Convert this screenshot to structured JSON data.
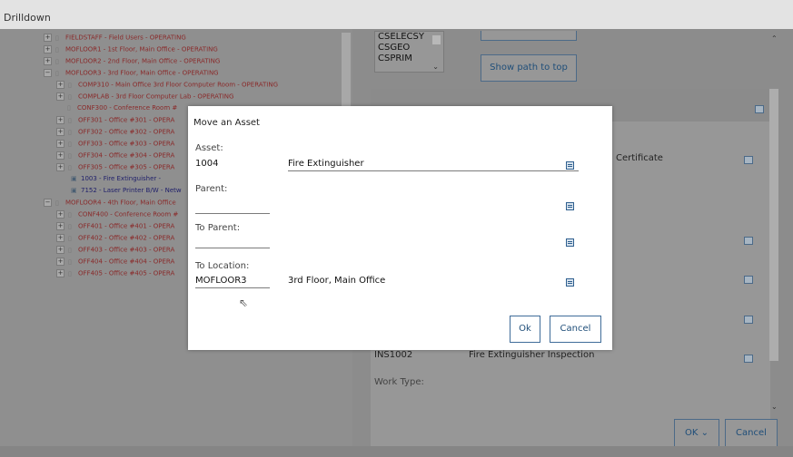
{
  "window": {
    "title": "Drilldown"
  },
  "tree": {
    "items": [
      {
        "expander": "+",
        "label": "FIELDSTAFF - Field Users - OPERATING",
        "type": "location"
      },
      {
        "expander": "+",
        "label": "MOFLOOR1 - 1st Floor, Main Office - OPERATING",
        "type": "location"
      },
      {
        "expander": "+",
        "label": "MOFLOOR2 - 2nd Floor, Main Office - OPERATING",
        "type": "location"
      },
      {
        "expander": "−",
        "label": "MOFLOOR3 - 3rd Floor, Main Office - OPERATING",
        "type": "location"
      },
      {
        "expander": "+",
        "label": "COMP310 - Main Office 3rd Floor Computer Room - OPERATING",
        "type": "location"
      },
      {
        "expander": "+",
        "label": "COMPLAB - 3rd Floor Computer Lab - OPERATING",
        "type": "location"
      },
      {
        "expander": "",
        "label": "CONF300 - Conference Room #",
        "type": "location"
      },
      {
        "expander": "+",
        "label": "OFF301 - Office #301 - OPERA",
        "type": "location"
      },
      {
        "expander": "+",
        "label": "OFF302 - Office #302 - OPERA",
        "type": "location"
      },
      {
        "expander": "+",
        "label": "OFF303 - Office #303 - OPERA",
        "type": "location"
      },
      {
        "expander": "+",
        "label": "OFF304 - Office #304 - OPERA",
        "type": "location"
      },
      {
        "expander": "+",
        "label": "OFF305 - Office #305 - OPERA",
        "type": "location"
      },
      {
        "expander": "",
        "label": "1003 - Fire Extinguisher -",
        "type": "asset"
      },
      {
        "expander": "",
        "label": "7152 - Laser Printer B/W - Netw",
        "type": "asset"
      },
      {
        "expander": "−",
        "label": "MOFLOOR4 - 4th Floor, Main Office",
        "type": "location"
      },
      {
        "expander": "+",
        "label": "CONF400 - Conference Room #",
        "type": "location"
      },
      {
        "expander": "+",
        "label": "OFF401 - Office #401 - OPERA",
        "type": "location"
      },
      {
        "expander": "+",
        "label": "OFF402 - Office #402 - OPERA",
        "type": "location"
      },
      {
        "expander": "+",
        "label": "OFF403 - Office #403 - OPERA",
        "type": "location"
      },
      {
        "expander": "+",
        "label": "OFF404 - Office #404 - OPERA",
        "type": "location"
      },
      {
        "expander": "+",
        "label": "OFF405 - Office #405 - OPERA",
        "type": "location"
      }
    ]
  },
  "right_panel": {
    "systems": [
      "CSELECSY",
      "CSGEO",
      "CSPRIM"
    ],
    "show_path_label": "Show path to top",
    "cert_text": "Certificate",
    "inspection_code": "INS1002",
    "inspection_desc": "Fire Extinguisher Inspection",
    "work_type_label": "Work Type:",
    "ok_label": "OK",
    "cancel_label": "Cancel"
  },
  "modal": {
    "title": "Move an Asset",
    "asset_label": "Asset:",
    "asset_value": "1004",
    "asset_desc": "Fire Extinguisher",
    "parent_label": "Parent:",
    "to_parent_label": "To Parent:",
    "to_location_label": "To Location:",
    "to_location_value": "MOFLOOR3",
    "to_location_desc": "3rd Floor, Main Office",
    "ok_label": "Ok",
    "cancel_label": "Cancel"
  },
  "icons": {
    "tree_node": "location-node-icon",
    "asset_node": "asset-node-icon",
    "lookup": "lookup-icon"
  }
}
